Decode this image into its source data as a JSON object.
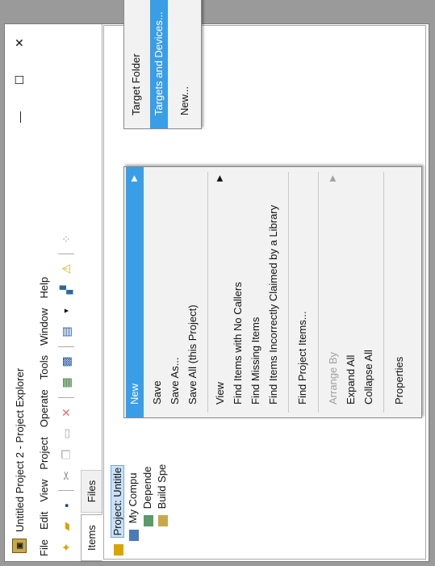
{
  "window": {
    "title": "Untitled Project 2 - Project Explorer",
    "controls": {
      "minimize": "—",
      "maximize": "☐",
      "close": "✕"
    }
  },
  "menubar": [
    "File",
    "Edit",
    "View",
    "Project",
    "Operate",
    "Tools",
    "Window",
    "Help"
  ],
  "tabs": [
    {
      "label": "Items",
      "active": true
    },
    {
      "label": "Files",
      "active": false
    }
  ],
  "tree": {
    "project": "Project: Untitle",
    "computer": "My Compu",
    "dependencies": "Depende",
    "build": "Build Spe"
  },
  "context_menu": {
    "new": "New",
    "save": "Save",
    "save_as": "Save As...",
    "save_all": "Save All (this Project)",
    "view": "View",
    "find_no_callers": "Find Items with No Callers",
    "find_missing": "Find Missing Items",
    "find_incorrect": "Find Items Incorrectly Claimed by a Library",
    "find_project_items": "Find Project Items...",
    "arrange_by": "Arrange By",
    "expand_all": "Expand All",
    "collapse_all": "Collapse All",
    "properties": "Properties"
  },
  "submenu": {
    "target_folder": "Target Folder",
    "targets_devices": "Targets and Devices...",
    "new": "New..."
  },
  "colors": {
    "highlight": "#3a9ee6",
    "background": "#9a9a9a"
  }
}
